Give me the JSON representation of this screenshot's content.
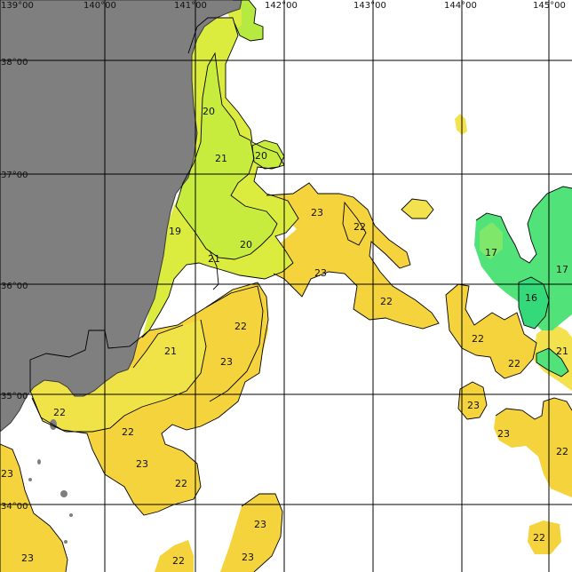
{
  "map": {
    "longitude_labels": [
      "139°00",
      "140°00",
      "141°00",
      "142°00",
      "143°00",
      "144°00",
      "145°00"
    ],
    "latitude_labels": [
      "38°00",
      "37°00",
      "36°00",
      "35°00",
      "34°00"
    ],
    "colors": {
      "ocean_no_data": "#ffffff",
      "land": "#7f7f7f",
      "temp_23": "#f5d33c",
      "temp_22": "#f3e14d",
      "temp_21": "#e9ec4a",
      "temp_20": "#d2ee3e",
      "temp_19": "#b6ea40",
      "temp_17": "#52e27a",
      "temp_16": "#34d97a",
      "grid": "#000000",
      "contour": "#000000"
    },
    "temperature_labels": [
      {
        "id": "t1",
        "value": "20"
      },
      {
        "id": "t2",
        "value": "21"
      },
      {
        "id": "t3",
        "value": "20"
      },
      {
        "id": "t4",
        "value": "23"
      },
      {
        "id": "t5",
        "value": "22"
      },
      {
        "id": "t6",
        "value": "19"
      },
      {
        "id": "t7",
        "value": "20"
      },
      {
        "id": "t8",
        "value": "21"
      },
      {
        "id": "t9",
        "value": "23"
      },
      {
        "id": "t10",
        "value": "22"
      },
      {
        "id": "t11",
        "value": "17"
      },
      {
        "id": "t12",
        "value": "17"
      },
      {
        "id": "t13",
        "value": "16"
      },
      {
        "id": "t14",
        "value": "22"
      },
      {
        "id": "t15",
        "value": "22"
      },
      {
        "id": "t16",
        "value": "21"
      },
      {
        "id": "t17",
        "value": "22"
      },
      {
        "id": "t18",
        "value": "23"
      },
      {
        "id": "t19",
        "value": "21"
      },
      {
        "id": "t20",
        "value": "22"
      },
      {
        "id": "t21",
        "value": "23"
      },
      {
        "id": "t22",
        "value": "22"
      },
      {
        "id": "t23",
        "value": "23"
      },
      {
        "id": "t24",
        "value": "23"
      },
      {
        "id": "t25",
        "value": "22"
      },
      {
        "id": "t26",
        "value": "22"
      },
      {
        "id": "t27",
        "value": "23"
      },
      {
        "id": "t28",
        "value": "23"
      },
      {
        "id": "t29",
        "value": "22"
      },
      {
        "id": "t30",
        "value": "22"
      },
      {
        "id": "t31",
        "value": "23"
      }
    ]
  }
}
